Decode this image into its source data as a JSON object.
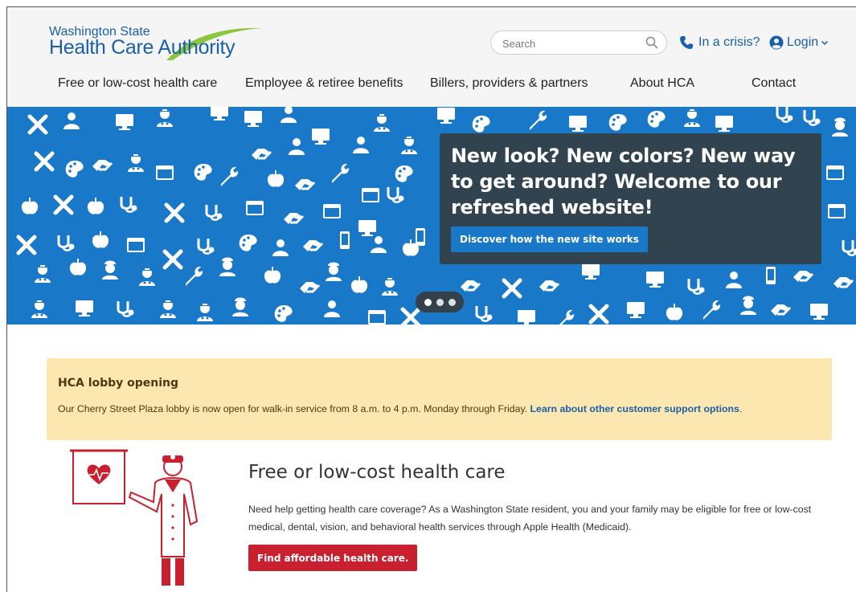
{
  "colors": {
    "brand_blue": "#1a5fa8",
    "hero_blue": "#1a78c9",
    "hero_card": "#34404a",
    "alert_bg": "#fde7b0",
    "alert_text": "#4a3a10",
    "cta_red": "#c8202e",
    "logo_green": "#8cc63f"
  },
  "header": {
    "logo_line1": "Washington State",
    "logo_line2_a": "Health Care ",
    "logo_line2_b": "Authority",
    "search_placeholder": "Search",
    "search_icon": "magnifier",
    "crisis_icon": "phone",
    "crisis_label": "In a crisis?",
    "login_icon": "user-circle",
    "login_label": "Login",
    "login_chevron": "chevron-down"
  },
  "nav": {
    "items": [
      "Free or low-cost health care",
      "Employee & retiree benefits",
      "Billers, providers & partners",
      "About HCA",
      "Contact"
    ]
  },
  "hero": {
    "title": "New look? New colors? New way to get around? Welcome to our refreshed website!",
    "button_label": "Discover how the new site works",
    "slides": 3,
    "active_slide": 1
  },
  "alert": {
    "title": "HCA lobby opening",
    "body": "Our Cherry Street Plaza lobby is now open for walk-in service from 8 a.m. to 4 p.m. Monday through Friday.",
    "link_label": "Learn about other customer support options",
    "trailing": "."
  },
  "feature": {
    "title": "Free or low-cost health care",
    "body": "Need help getting health care coverage? As a Washington State resident, you and your family may be eligible for free or low-cost medical, dental, vision, and behavioral health services through Apple Health (Medicaid).",
    "button_label": "Find affordable health care.",
    "illustration": "doctor-with-heart-chart"
  }
}
